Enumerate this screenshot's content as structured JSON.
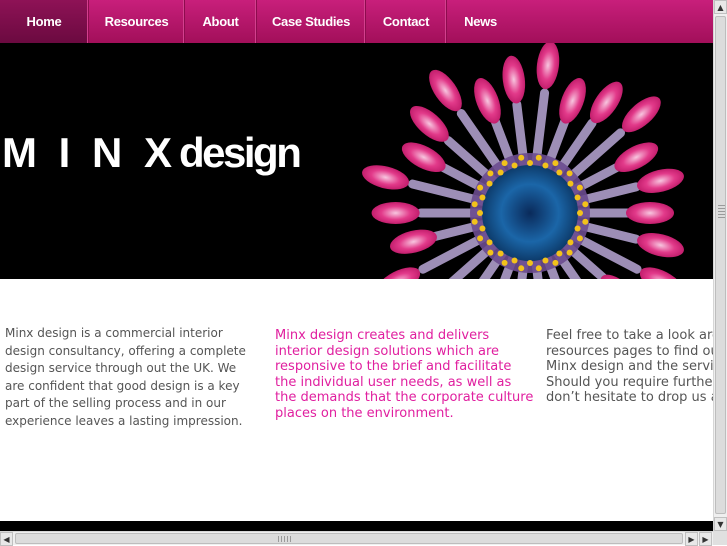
{
  "nav": {
    "items": [
      {
        "label": "Home",
        "active": true
      },
      {
        "label": "Resources",
        "active": false
      },
      {
        "label": "About",
        "active": false
      },
      {
        "label": "Case Studies",
        "active": false
      },
      {
        "label": "Contact",
        "active": false
      },
      {
        "label": "News",
        "active": false
      }
    ]
  },
  "hero": {
    "logo_spaced": "M I N X",
    "logo_word": "design"
  },
  "content": {
    "col1": "Minx design is a commercial interior design consultancy, offering a complete design service through out the UK. We are confident that good design is a key part of the selling process and in our experience leaves a lasting impression.",
    "col2": "Minx design creates and delivers interior design solutions which are responsive to the brief and facilitate the individual user needs, as well as the demands that the corporate culture places on the environment.",
    "col3_lines": [
      "Feel free to take a look aro",
      "resources pages to find ou",
      "Minx design and the servic",
      "Should you require further",
      "don’t hesitate to drop us a"
    ]
  },
  "colors": {
    "nav": "#b5176b",
    "accent_text": "#e01f9f",
    "body_text": "#555555"
  },
  "scrollbars": {
    "up": "▲",
    "down": "▼",
    "left": "◀",
    "right": "▶"
  }
}
